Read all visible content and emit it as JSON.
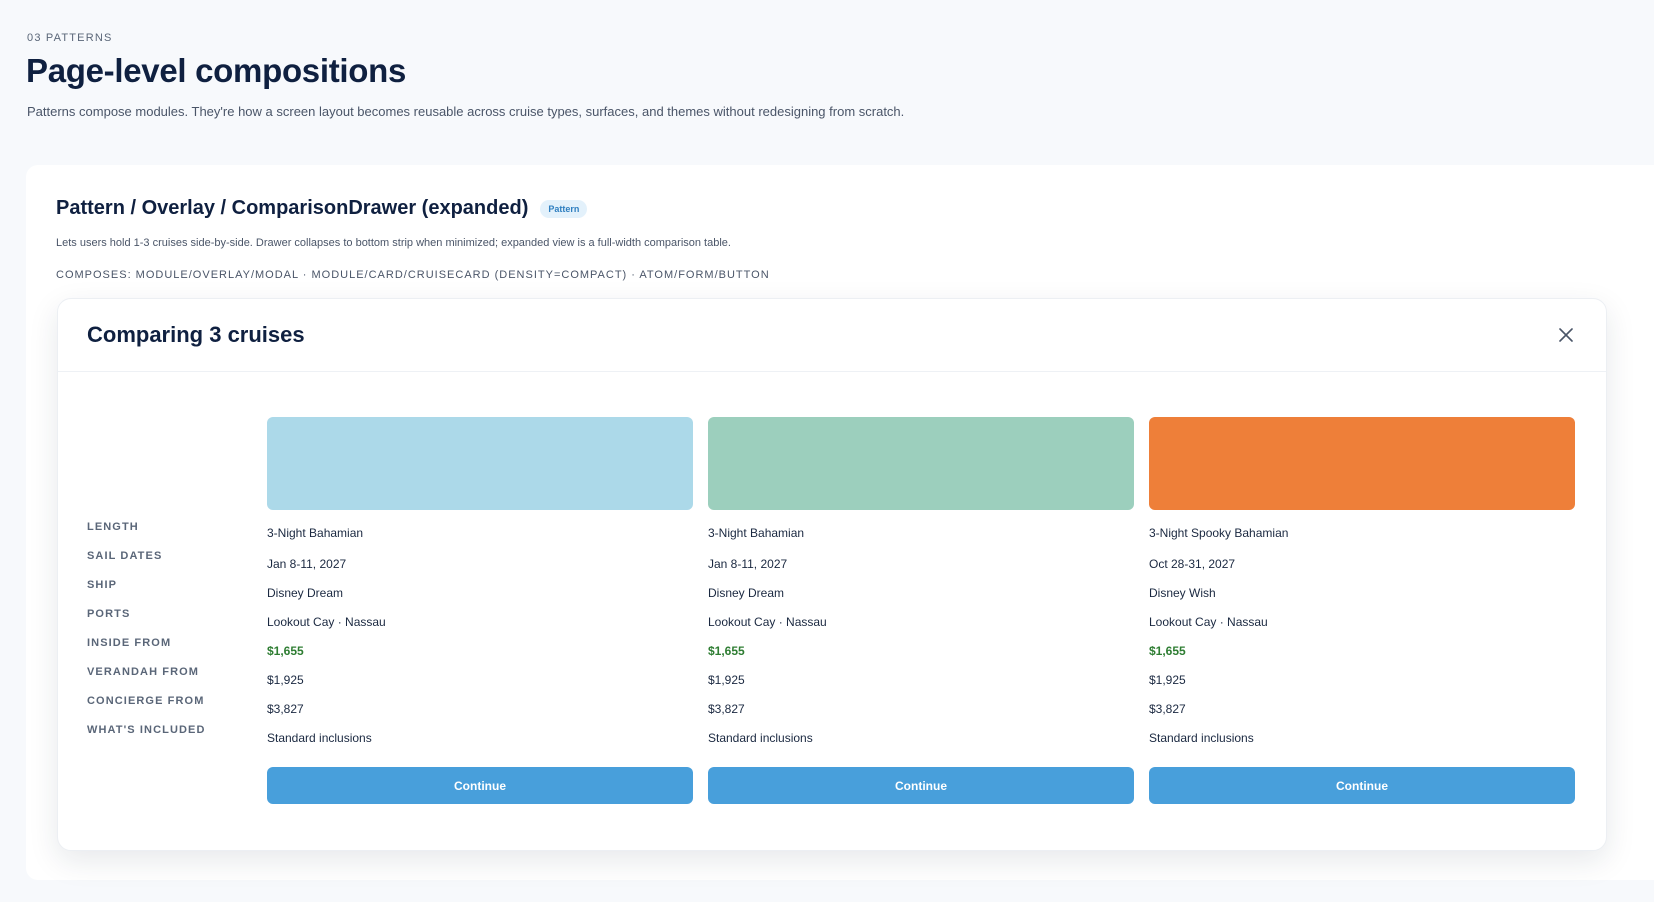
{
  "page": {
    "eyebrow": "03 PATTERNS",
    "title": "Page-level compositions",
    "description": "Patterns compose modules. They're how a screen layout becomes reusable across cruise types, surfaces, and themes without redesigning from scratch."
  },
  "pattern": {
    "title": "Pattern / Overlay / ComparisonDrawer (expanded)",
    "badge": "Pattern",
    "description": "Lets users hold 1-3 cruises side-by-side. Drawer collapses to bottom strip when minimized; expanded view is a full-width comparison table.",
    "composes": "COMPOSES: MODULE/OVERLAY/MODAL · MODULE/CARD/CRUISECARD (DENSITY=COMPACT) · ATOM/FORM/BUTTON"
  },
  "drawer": {
    "title": "Comparing 3 cruises",
    "close_icon": "close-icon",
    "row_labels": [
      "LENGTH",
      "SAIL DATES",
      "SHIP",
      "PORTS",
      "INSIDE FROM",
      "VERANDAH FROM",
      "CONCIERGE FROM",
      "WHAT'S INCLUDED"
    ],
    "price_color": "#2e7d32",
    "button_color": "#489fdb",
    "cruises": [
      {
        "swatch_color": "#acd9e9",
        "length": "3-Night Bahamian",
        "sail_dates": "Jan 8-11, 2027",
        "ship": "Disney Dream",
        "ports": "Lookout Cay · Nassau",
        "inside_from": "$1,655",
        "verandah_from": "$1,925",
        "concierge_from": "$3,827",
        "included": "Standard inclusions",
        "button": "Continue"
      },
      {
        "swatch_color": "#9ccfbd",
        "length": "3-Night Bahamian",
        "sail_dates": "Jan 8-11, 2027",
        "ship": "Disney Dream",
        "ports": "Lookout Cay · Nassau",
        "inside_from": "$1,655",
        "verandah_from": "$1,925",
        "concierge_from": "$3,827",
        "included": "Standard inclusions",
        "button": "Continue"
      },
      {
        "swatch_color": "#ee7f39",
        "length": "3-Night Spooky Bahamian",
        "sail_dates": "Oct 28-31, 2027",
        "ship": "Disney Wish",
        "ports": "Lookout Cay · Nassau",
        "inside_from": "$1,655",
        "verandah_from": "$1,925",
        "concierge_from": "$3,827",
        "included": "Standard inclusions",
        "button": "Continue"
      }
    ]
  }
}
